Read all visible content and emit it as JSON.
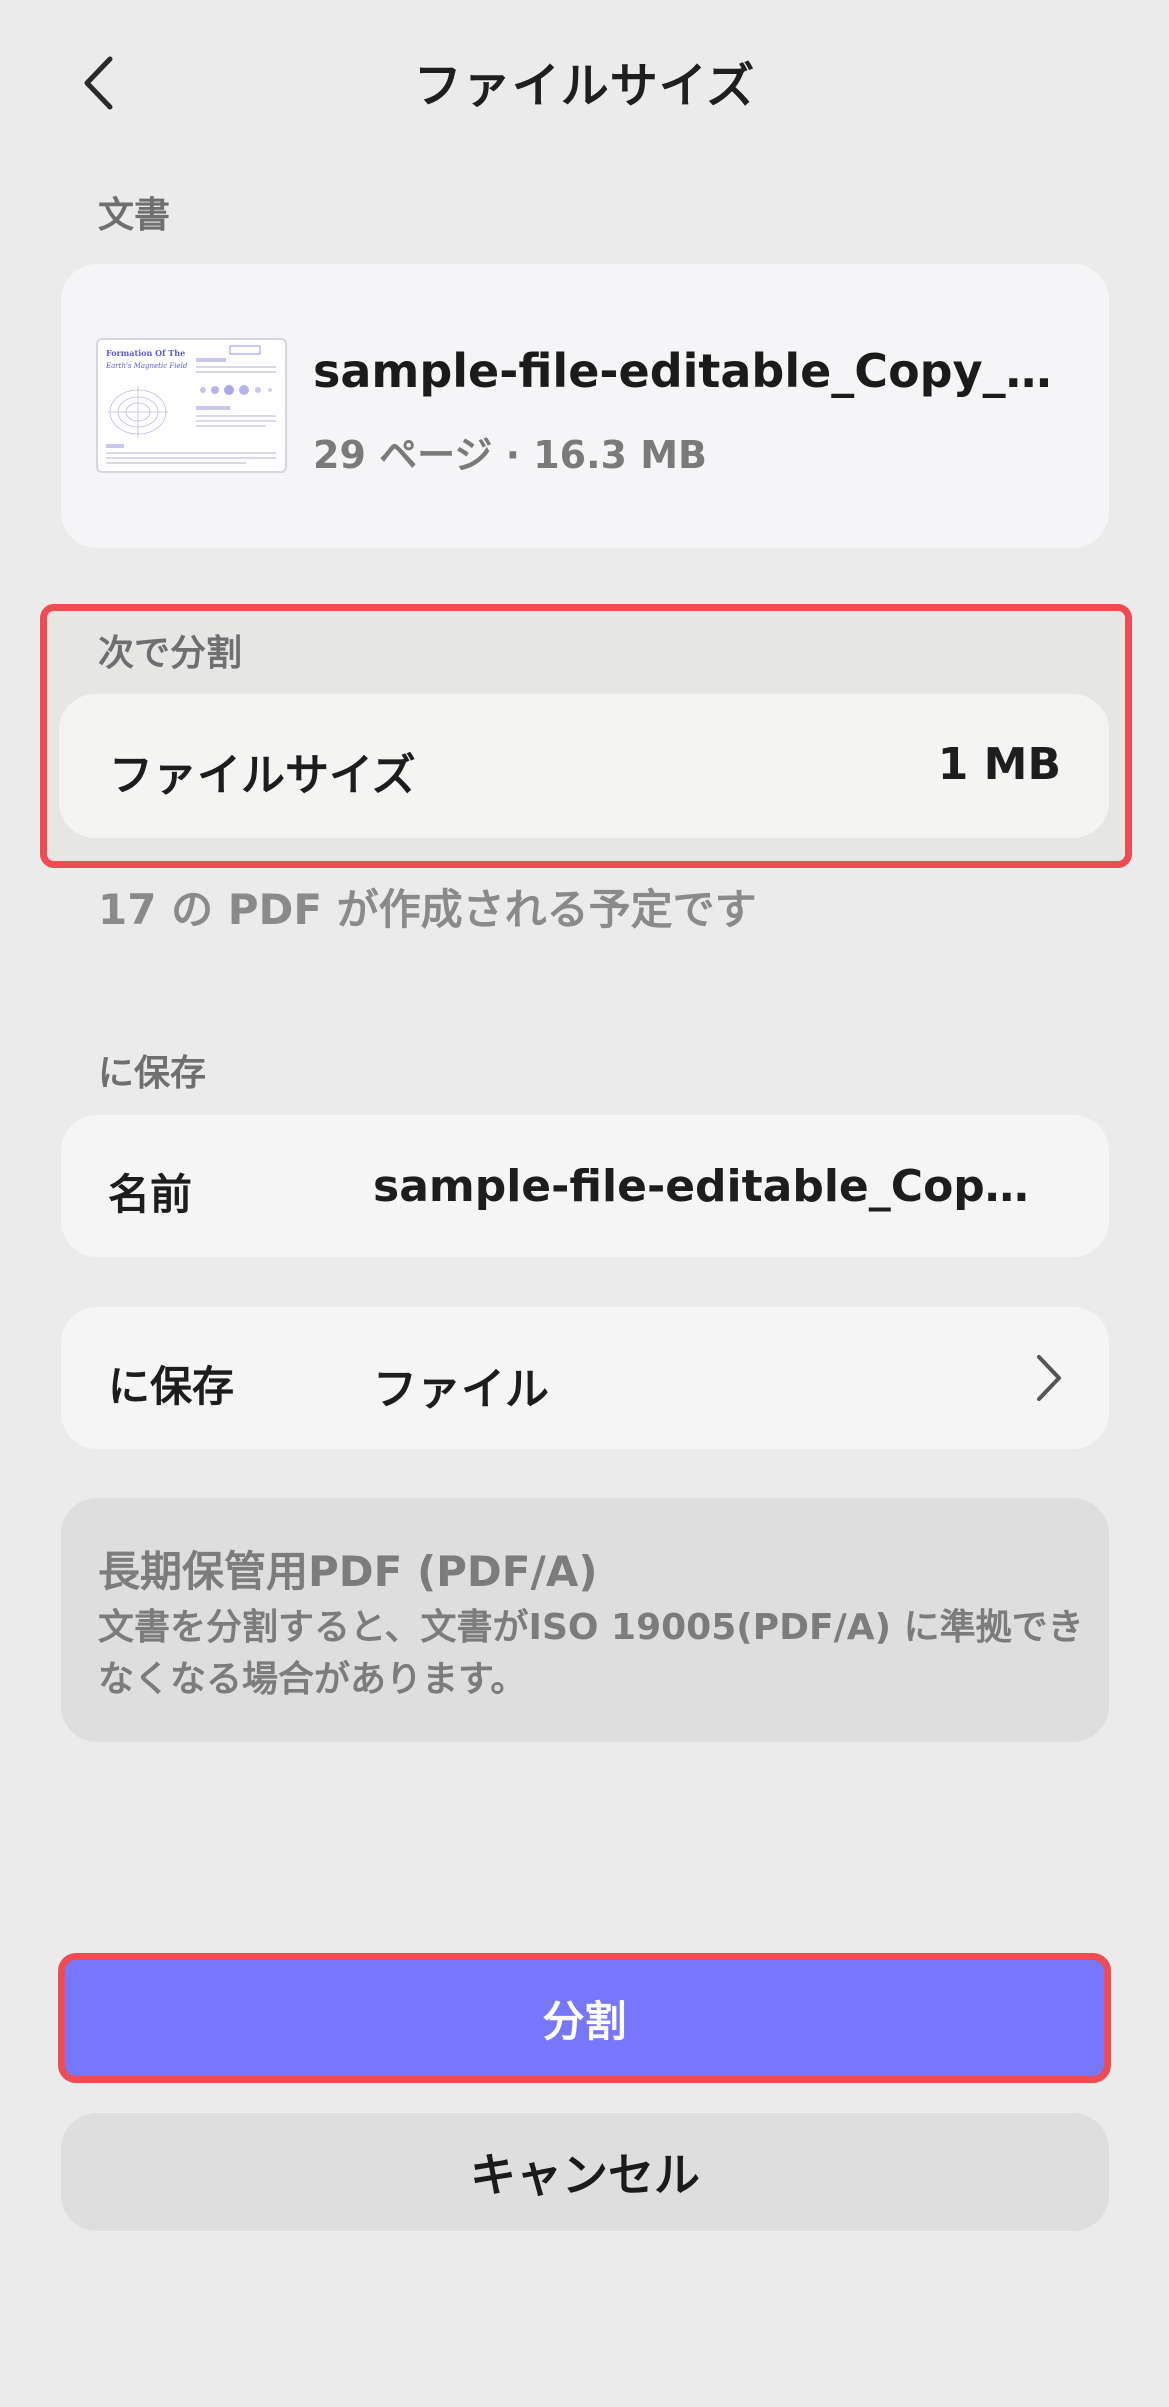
{
  "header": {
    "title": "ファイルサイズ",
    "back_icon": "chevron-left-icon"
  },
  "document_section": {
    "label": "文書",
    "file_name": "sample-file-editable_Copy_Co...",
    "meta": "29 ページ · 16.3 MB",
    "thumbnail": {
      "title_line1": "Formation Of The",
      "title_line2": "Earth's Magnetic Field"
    }
  },
  "split_section": {
    "label": "次で分割",
    "row_label": "ファイルサイズ",
    "row_value": "1 MB",
    "note": "17 の PDF が作成される予定です"
  },
  "save_section": {
    "label": "に保存",
    "name_label": "名前",
    "name_value": "sample-file-editable_Copy_...",
    "location_label": "に保存",
    "location_value": "ファイル",
    "location_icon": "chevron-right-icon"
  },
  "pdfa_info": {
    "title": "長期保管用PDF (PDF/A)",
    "body": "文書を分割すると、文書がISO 19005(PDF/A) に準拠できなくなる場合があります。"
  },
  "actions": {
    "split_label": "分割",
    "cancel_label": "キャンセル"
  },
  "colors": {
    "accent": "#7777fb",
    "highlight": "#ef4b53",
    "background": "#ebebeb"
  }
}
